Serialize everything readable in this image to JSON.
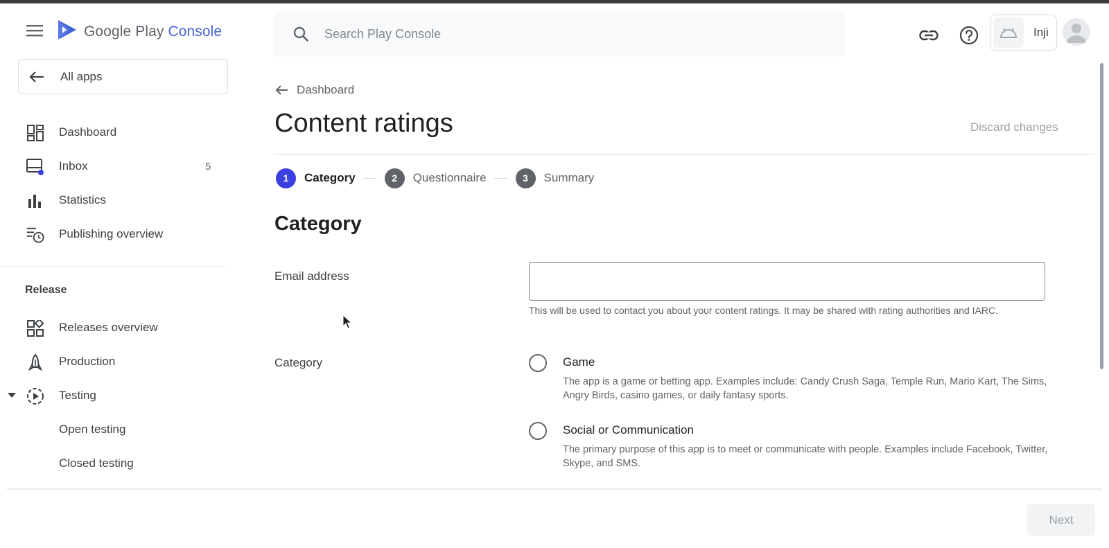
{
  "header": {
    "logo_brand": "Google Play",
    "logo_accent": "Console",
    "search_placeholder": "Search Play Console",
    "developer_name": "Inji"
  },
  "sidebar": {
    "all_apps_label": "All apps",
    "items": [
      {
        "label": "Dashboard",
        "icon": "dashboard-icon"
      },
      {
        "label": "Inbox",
        "icon": "inbox-icon",
        "count": "5"
      },
      {
        "label": "Statistics",
        "icon": "bar-chart-icon"
      },
      {
        "label": "Publishing overview",
        "icon": "publishing-history-icon"
      }
    ],
    "release_section_title": "Release",
    "release_items": [
      {
        "label": "Releases overview",
        "icon": "releases-overview-icon"
      },
      {
        "label": "Production",
        "icon": "production-icon"
      },
      {
        "label": "Testing",
        "icon": "testing-icon"
      },
      {
        "label": "Open testing"
      },
      {
        "label": "Closed testing"
      }
    ]
  },
  "main": {
    "breadcrumb_label": "Dashboard",
    "page_title": "Content ratings",
    "discard_label": "Discard changes",
    "steps": [
      {
        "number": "1",
        "label": "Category",
        "state": "active"
      },
      {
        "number": "2",
        "label": "Questionnaire",
        "state": "inactive"
      },
      {
        "number": "3",
        "label": "Summary",
        "state": "inactive"
      }
    ],
    "section_heading": "Category",
    "email_label": "Email address",
    "email_value": "",
    "email_helper": "This will be used to contact you about your content ratings. It may be shared with rating authorities and IARC.",
    "category_label": "Category",
    "category_options": [
      {
        "title": "Game",
        "description": "The app is a game or betting app. Examples include: Candy Crush Saga, Temple Run, Mario Kart, The Sims, Angry Birds, casino games, or daily fantasy sports.",
        "selected": false
      },
      {
        "title": "Social or Communication",
        "description": "The primary purpose of this app is to meet or communicate with people. Examples include Facebook, Twitter, Skype, and SMS.",
        "selected": false
      }
    ]
  },
  "footer": {
    "next_label": "Next"
  },
  "colors": {
    "accent": "#3c3fe0",
    "logo_accent": "#4464d6",
    "inbox_dot": "#3c3fe0"
  }
}
